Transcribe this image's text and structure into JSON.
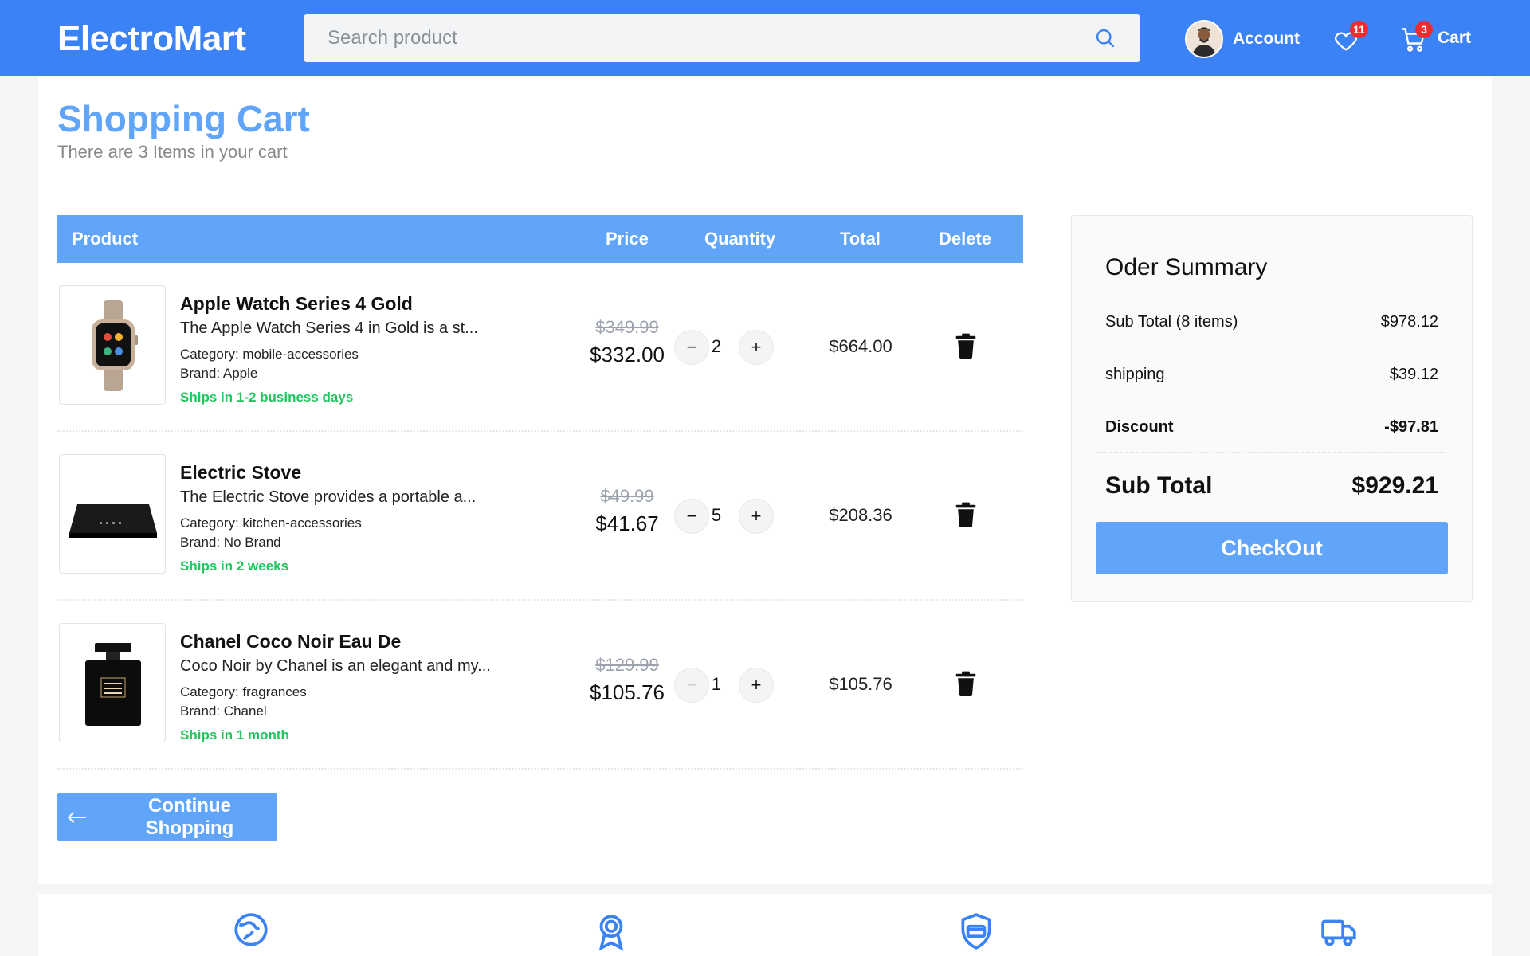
{
  "header": {
    "logo": "ElectroMart",
    "search_placeholder": "Search product",
    "account_label": "Account",
    "wishlist_count": "11",
    "cart_count": "3",
    "cart_label": "Cart",
    "brand_color": "#3b82f6"
  },
  "page": {
    "title": "Shopping Cart",
    "subtitle": "There are 3 Items in your cart"
  },
  "table": {
    "headers": [
      "Product",
      "Price",
      "Quantity",
      "Total",
      "Delete"
    ]
  },
  "items": [
    {
      "name": "Apple Watch Series 4 Gold",
      "description": "The Apple Watch Series 4 in Gold is a st...",
      "category": "Category: mobile-accessories",
      "brand": "Brand: Apple",
      "shipping": "Ships in 1-2 business days",
      "old_price": "$349.99",
      "price": "$332.00",
      "quantity": "2",
      "total": "$664.00"
    },
    {
      "name": "Electric Stove",
      "description": "The Electric Stove provides a portable a...",
      "category": "Category: kitchen-accessories",
      "brand": "Brand: No Brand",
      "shipping": "Ships in 2 weeks",
      "old_price": "$49.99",
      "price": "$41.67",
      "quantity": "5",
      "total": "$208.36"
    },
    {
      "name": "Chanel Coco Noir Eau De",
      "description": "Coco Noir by Chanel is an elegant and my...",
      "category": "Category: fragrances",
      "brand": "Brand: Chanel",
      "shipping": "Ships in 1 month",
      "old_price": "$129.99",
      "price": "$105.76",
      "quantity": "1",
      "total": "$105.76"
    }
  ],
  "continue_label": "Continue Shopping",
  "summary": {
    "title": "Oder Summary",
    "subtotal_label": "Sub Total (8 items)",
    "subtotal_value": "$978.12",
    "shipping_label": "shipping",
    "shipping_value": "$39.12",
    "discount_label": "Discount",
    "discount_value": "-$97.81",
    "total_label": "Sub Total",
    "total_value": "$929.21",
    "checkout_label": "CheckOut"
  },
  "icons": {
    "search": "search-icon",
    "heart": "heart-icon",
    "cart": "cart-icon",
    "trash": "trash-icon",
    "arrow": "arrow-left-icon",
    "features": [
      "globe-icon",
      "award-ribbon-icon",
      "shield-card-icon",
      "delivery-truck-icon"
    ]
  }
}
